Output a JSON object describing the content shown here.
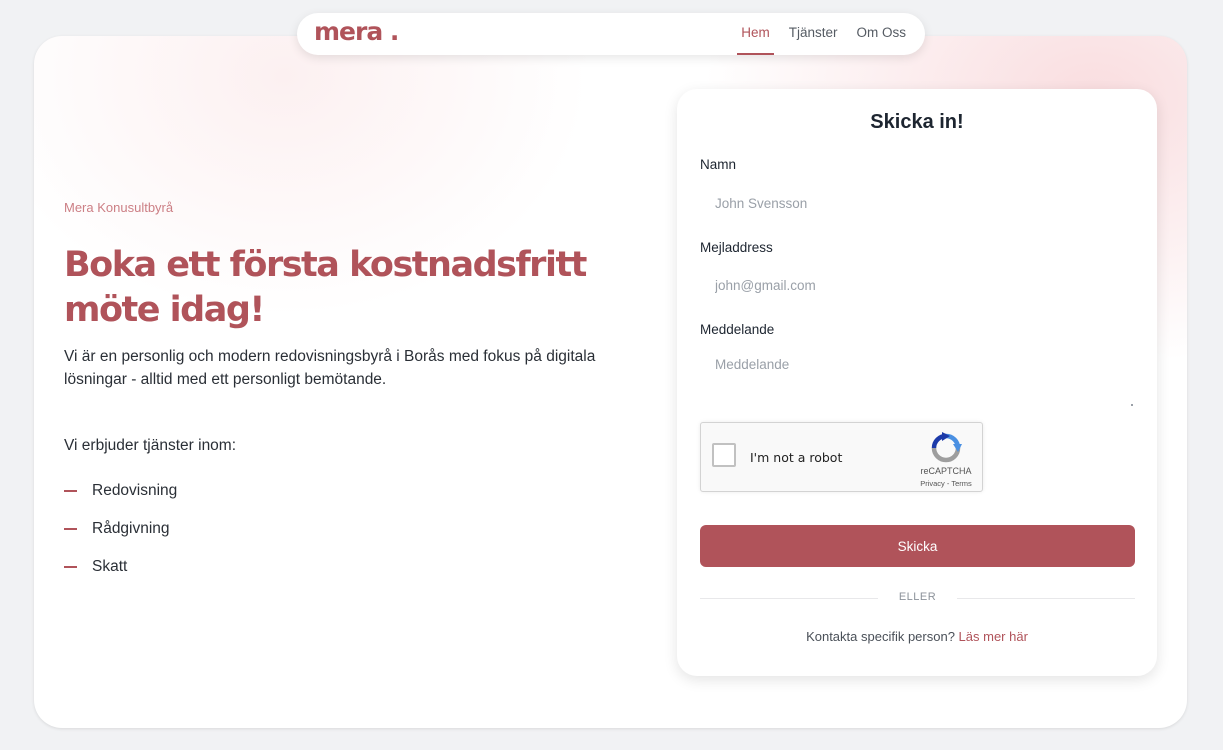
{
  "header": {
    "logo_text": "mera .",
    "nav": [
      {
        "label": "Hem",
        "active": true
      },
      {
        "label": "Tjänster",
        "active": false
      },
      {
        "label": "Om Oss",
        "active": false
      }
    ]
  },
  "hero": {
    "eyebrow": "Mera Konusultbyrå",
    "title": "Boka ett första kostnadsfritt möte idag!",
    "description": "Vi är en personlig och modern redovisningsbyrå i Borås med fokus på digitala lösningar - alltid med ett personligt bemötande.",
    "offer_intro": "Vi erbjuder tjänster inom:",
    "services": [
      "Redovisning",
      "Rådgivning",
      "Skatt"
    ]
  },
  "form": {
    "title": "Skicka in!",
    "name_label": "Namn",
    "name_placeholder": "John Svensson",
    "name_value": "",
    "email_label": "Mejladdress",
    "email_placeholder": "john@gmail.com",
    "email_value": "",
    "message_label": "Meddelande",
    "message_placeholder": "Meddelande",
    "message_value": "",
    "recaptcha": {
      "label": "I'm not a robot",
      "brand": "reCAPTCHA",
      "privacy": "Privacy",
      "separator": " - ",
      "terms": "Terms",
      "checked": false
    },
    "submit_label": "Skicka",
    "divider_text": "ELLER",
    "contact_text": "Kontakta specifik person? ",
    "contact_link": "Läs mer här"
  },
  "colors": {
    "accent": "#b0535a",
    "eyebrow": "#cc7f85",
    "text": "#2a2f36",
    "background": "#f1f2f4"
  },
  "icons": {
    "dash": "dash-icon",
    "recaptcha": "recaptcha-logo-icon"
  }
}
